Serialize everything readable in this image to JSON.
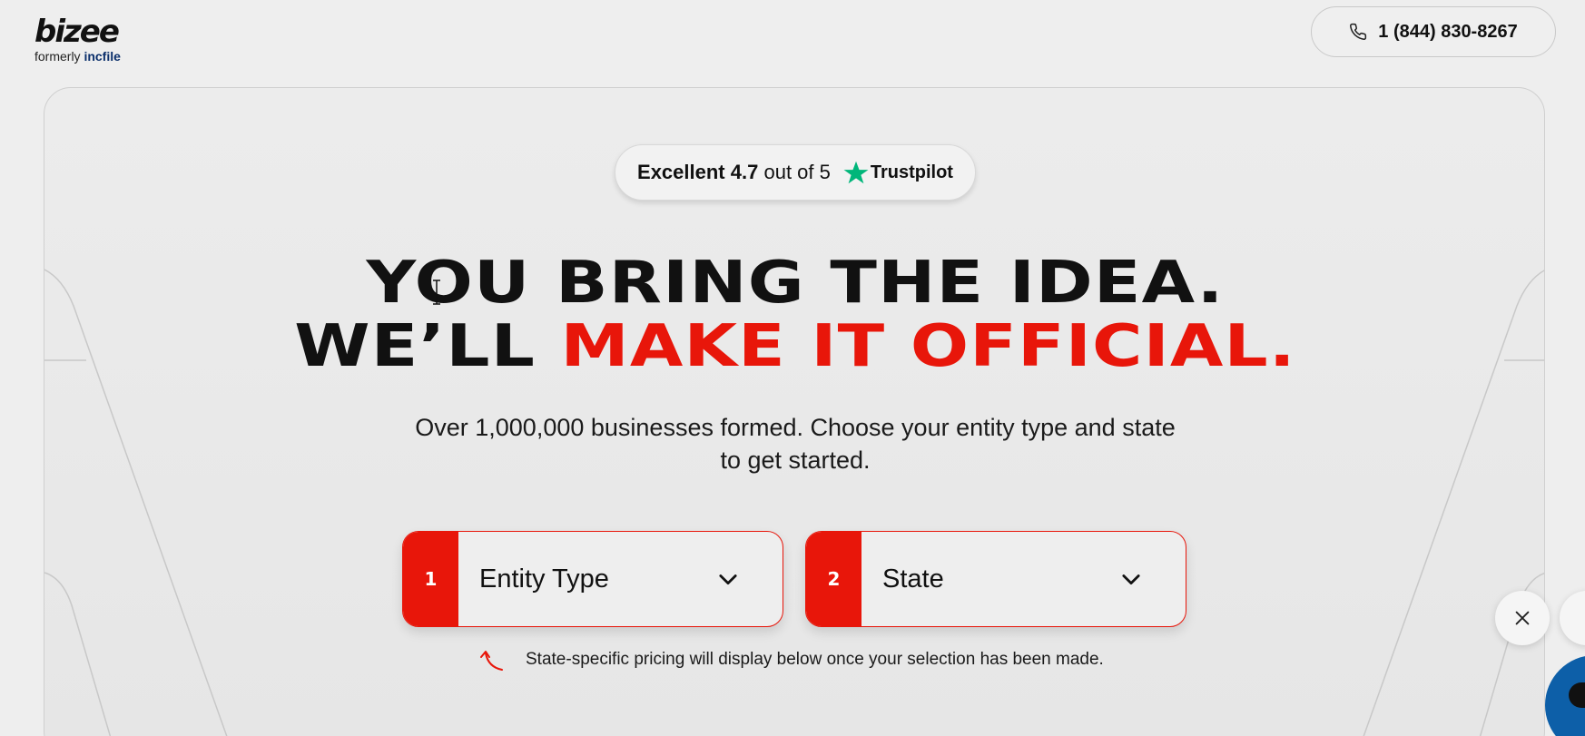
{
  "header": {
    "logo_text": "bizee",
    "logo_sub_prefix": "formerly",
    "logo_sub_brand": "incfile",
    "phone": "1 (844) 830-8267",
    "phone_icon": "phone-icon"
  },
  "hero": {
    "rating": {
      "prefix": "Excellent",
      "score": "4.7",
      "suffix": "out of 5",
      "brand": "Trustpilot",
      "brand_color": "#00b67a"
    },
    "headline_line1": "YOU BRING THE IDEA.",
    "headline_line2_dark": "WE’LL",
    "headline_line2_red": "MAKE IT OFFICIAL.",
    "accent_color": "#e8160a",
    "subtitle_line1": "Over 1,000,000 businesses formed. Choose your entity type and state",
    "subtitle_line2": "to get started.",
    "selects": [
      {
        "number": "1",
        "label": "Entity Type"
      },
      {
        "number": "2",
        "label": "State"
      }
    ],
    "note": "State-specific pricing will display below once your selection has been made."
  },
  "widgets": {
    "close_icon": "close-icon",
    "chat_color": "#0d5fa8"
  }
}
